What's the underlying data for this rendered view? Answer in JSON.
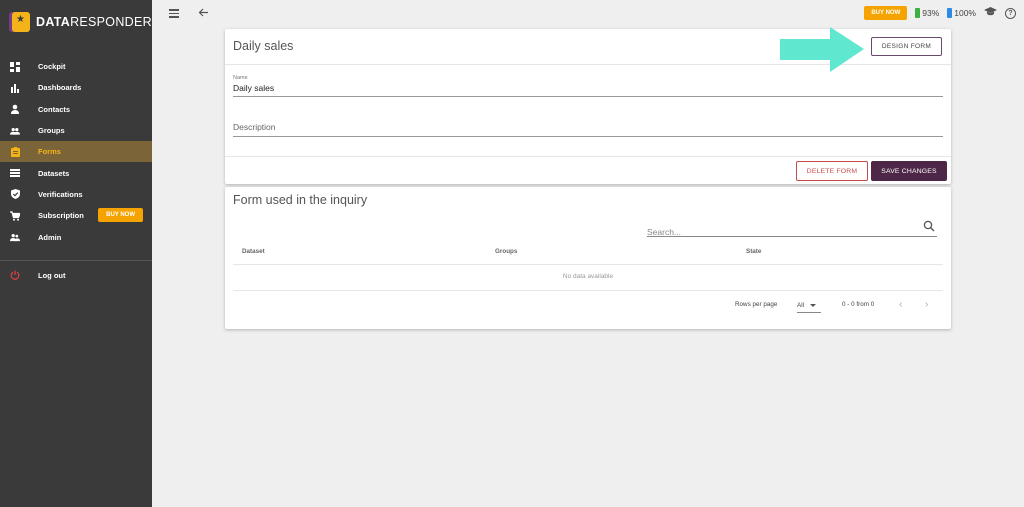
{
  "app": {
    "logo_bold": "DATA",
    "logo_light": "RESPONDER"
  },
  "sidebar": {
    "items": [
      {
        "label": "Cockpit",
        "icon": "dashboard-grid-icon"
      },
      {
        "label": "Dashboards",
        "icon": "bar-chart-icon"
      },
      {
        "label": "Contacts",
        "icon": "person-icon"
      },
      {
        "label": "Groups",
        "icon": "people-icon"
      },
      {
        "label": "Forms",
        "icon": "clipboard-icon",
        "active": true
      },
      {
        "label": "Datasets",
        "icon": "list-icon"
      },
      {
        "label": "Verifications",
        "icon": "shield-check-icon"
      },
      {
        "label": "Subscription",
        "icon": "cart-icon",
        "badge": "BUY NOW"
      },
      {
        "label": "Admin",
        "icon": "admin-people-icon"
      }
    ],
    "logout": {
      "label": "Log out",
      "icon": "power-icon"
    }
  },
  "topbar": {
    "buy_now": "BUY NOW",
    "battery_green": "93%",
    "battery_blue": "100%"
  },
  "form_card": {
    "title": "Daily sales",
    "design_form": "DESIGN FORM",
    "name_label": "Name",
    "name_value": "Daily sales",
    "description_placeholder": "Description",
    "delete_form": "DELETE FORM",
    "save_changes": "SAVE CHANGES"
  },
  "inquiry_card": {
    "title": "Form used in the inquiry",
    "search_placeholder": "Search...",
    "columns": [
      "Dataset",
      "Groups",
      "State"
    ],
    "empty_text": "No data available",
    "rows_per_page_label": "Rows per page",
    "rows_per_page_value": "All",
    "range_text": "0 - 0 from 0"
  },
  "colors": {
    "sidebar_bg": "#3a3a3a",
    "accent_orange": "#f5a300",
    "active_item_bg": "#7a6438",
    "save_button": "#4e2748",
    "delete_button": "#c84b4b",
    "arrow": "#5fe8cf",
    "battery_green": "#3cb043",
    "battery_blue": "#2a8ce6"
  }
}
